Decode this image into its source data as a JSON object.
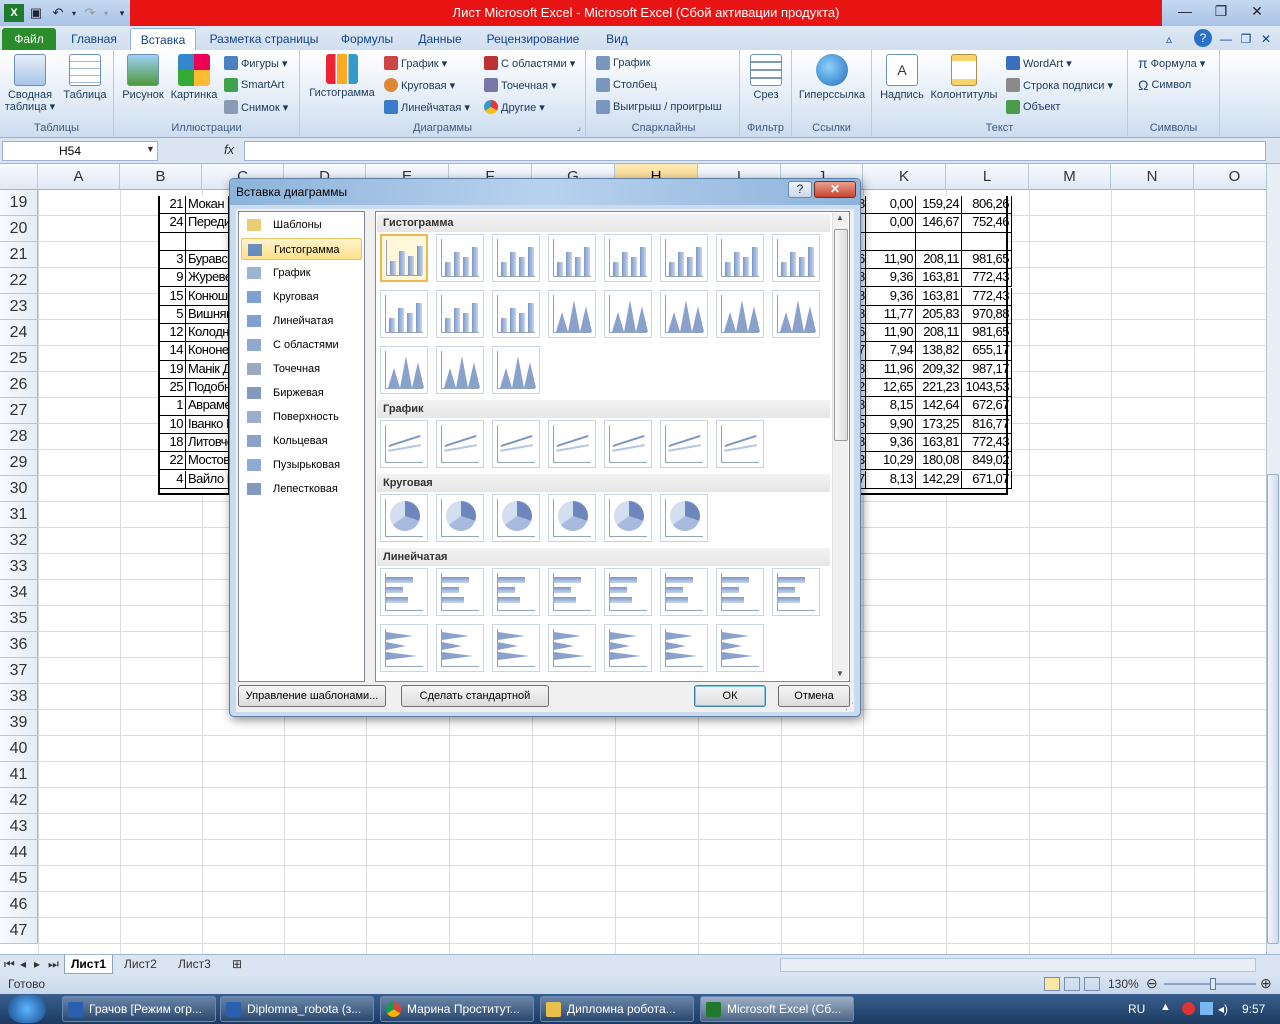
{
  "window": {
    "title": "Лист Microsoft Excel  -  Microsoft Excel (Сбой активации продукта)"
  },
  "ribbon": {
    "tabs": [
      "Файл",
      "Главная",
      "Вставка",
      "Разметка страницы",
      "Формулы",
      "Данные",
      "Рецензирование",
      "Вид"
    ],
    "active_tab": "Вставка",
    "groups": {
      "tables": {
        "label": "Таблицы",
        "pivot": "Сводная\nтаблица ▾",
        "table": "Таблица"
      },
      "illustrations": {
        "label": "Иллюстрации",
        "picture": "Рисунок",
        "clipart": "Картинка",
        "shapes": "Фигуры ▾",
        "smartart": "SmartArt",
        "screenshot": "Снимок ▾"
      },
      "charts": {
        "label": "Диаграммы",
        "column": "Гистограмма",
        "line": "График ▾",
        "pie": "Круговая ▾",
        "bar": "Линейчатая ▾",
        "area": "С областями ▾",
        "scatter": "Точечная ▾",
        "other": "Другие ▾"
      },
      "sparklines": {
        "label": "Спарклайны",
        "line": "График",
        "column": "Столбец",
        "winloss": "Выигрыш / проигрыш"
      },
      "filter": {
        "label": "Фильтр",
        "slicer": "Срез"
      },
      "links": {
        "label": "Ссылки",
        "hyperlink": "Гиперссылка"
      },
      "text": {
        "label": "Текст",
        "textbox": "Надпись",
        "headerfooter": "Колонтитулы",
        "wordart": "WordArt ▾",
        "sigline": "Строка подписи ▾",
        "object": "Объект"
      },
      "symbols": {
        "label": "Символы",
        "equation": "Формула ▾",
        "symbol": "Символ"
      }
    }
  },
  "formula_bar": {
    "name_box": "H54",
    "fx": "fx",
    "value": ""
  },
  "sheet": {
    "columns": [
      "A",
      "B",
      "C",
      "D",
      "E",
      "F",
      "G",
      "H",
      "I",
      "J",
      "K",
      "L",
      "M",
      "N",
      "O"
    ],
    "selected_column": "H",
    "rows": [
      "19",
      "20",
      "21",
      "22",
      "23",
      "24",
      "25",
      "26",
      "27",
      "28",
      "29",
      "30",
      "31",
      "32",
      "33",
      "34",
      "35",
      "36",
      "37",
      "38",
      "39",
      "40",
      "41",
      "42",
      "43",
      "44",
      "45",
      "46",
      "47"
    ],
    "table_left": [
      [
        "21",
        "Мокан"
      ],
      [
        "24",
        "Передир"
      ],
      [
        "",
        ""
      ],
      [
        "3",
        "Буравсі"
      ],
      [
        "9",
        "Журеве"
      ],
      [
        "15",
        "Конюше"
      ],
      [
        "5",
        "Вишняк"
      ],
      [
        "12",
        "Колодн"
      ],
      [
        "14",
        "Кононен"
      ],
      [
        "19",
        "Манік Д"
      ],
      [
        "25",
        "Подобн"
      ],
      [
        "1",
        "Аврамє"
      ],
      [
        "10",
        "Іванко І"
      ],
      [
        "18",
        "Литовче"
      ],
      [
        "22",
        "Мостова"
      ],
      [
        "4",
        "Вайло М"
      ]
    ],
    "table_right": [
      [
        "8",
        "0,00",
        "159,24",
        "806,26"
      ],
      [
        "",
        "0,00",
        "146,67",
        "752,46"
      ],
      [
        "",
        "",
        "",
        ""
      ],
      [
        "6",
        "11,90",
        "208,11",
        "981,65"
      ],
      [
        "8",
        "9,36",
        "163,81",
        "772,43"
      ],
      [
        "8",
        "9,36",
        "163,81",
        "772,43"
      ],
      [
        "8",
        "11,77",
        "205,83",
        "970,88"
      ],
      [
        "6",
        "11,90",
        "208,11",
        "981,65"
      ],
      [
        "7",
        "7,94",
        "138,82",
        "655,17"
      ],
      [
        "8",
        "11,96",
        "209,32",
        "987,17"
      ],
      [
        "2",
        "12,65",
        "221,23",
        "1043,53"
      ],
      [
        "8",
        "8,15",
        "142,64",
        "672,67"
      ],
      [
        "5",
        "9,90",
        "173,25",
        "816,77"
      ],
      [
        "8",
        "9,36",
        "163,81",
        "772,43"
      ],
      [
        "3",
        "10,29",
        "180,08",
        "849,02"
      ],
      [
        "7",
        "8,13",
        "142,29",
        "671,07"
      ]
    ],
    "sheet_tabs": [
      "Лист1",
      "Лист2",
      "Лист3"
    ],
    "active_sheet": "Лист1"
  },
  "status_bar": {
    "ready": "Готово",
    "zoom": "130%"
  },
  "dialog": {
    "title": "Вставка диаграммы",
    "help": "?",
    "close": "✕",
    "categories": [
      "Шаблоны",
      "Гистограмма",
      "График",
      "Круговая",
      "Линейчатая",
      "С областями",
      "Точечная",
      "Биржевая",
      "Поверхность",
      "Кольцевая",
      "Пузырьковая",
      "Лепестковая"
    ],
    "selected_category": "Гистограмма",
    "sections": {
      "column": "Гистограмма",
      "line": "График",
      "pie": "Круговая",
      "bar": "Линейчатая"
    },
    "buttons": {
      "manage": "Управление шаблонами...",
      "default": "Сделать стандартной",
      "ok": "ОК",
      "cancel": "Отмена"
    }
  },
  "taskbar": {
    "items": [
      "Грачов [Режим огр...",
      "Diplomna_robota (з...",
      "Марина Проститут...",
      "Дипломна робота...",
      "Microsoft Excel (Сб..."
    ],
    "lang": "RU",
    "time": "9:57"
  }
}
